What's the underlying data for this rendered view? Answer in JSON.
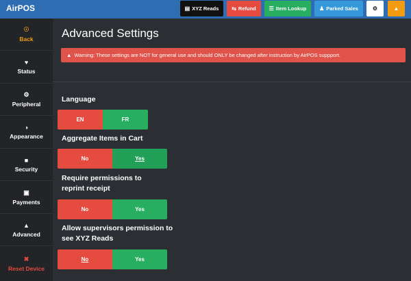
{
  "app": {
    "brand": "AirPOS"
  },
  "topbar": {
    "buttons": [
      {
        "label": "XYZ Reads",
        "icon": "document-icon",
        "color": "#111111"
      },
      {
        "label": "Refund",
        "icon": "refund-icon",
        "color": "#e54b3f"
      },
      {
        "label": "Item Lookup",
        "icon": "list-icon",
        "color": "#27ae60"
      },
      {
        "label": "Parked Sales",
        "icon": "users-icon",
        "color": "#3498db"
      },
      {
        "label": "",
        "icon": "gear-icon",
        "color": "#ffffff"
      },
      {
        "label": "",
        "icon": "bell-icon",
        "color": "#f39c12"
      }
    ]
  },
  "sidebar": {
    "items": [
      {
        "label": "Back",
        "icon": "back-circle-icon",
        "color": "#f39c12"
      },
      {
        "label": "Status",
        "icon": "heart-icon"
      },
      {
        "label": "Peripheral",
        "icon": "gear-icon"
      },
      {
        "label": "Appearance",
        "icon": "half-circle-icon"
      },
      {
        "label": "Security",
        "icon": "lock-icon"
      },
      {
        "label": "Payments",
        "icon": "cart-icon"
      },
      {
        "label": "Advanced",
        "icon": "warning-icon"
      },
      {
        "label": "Reset Device",
        "icon": "close-icon",
        "color": "#e54b3f"
      }
    ]
  },
  "main": {
    "title": "Advanced Settings",
    "warning": "Warning: These settings are NOT for general use and should ONLY be changed after instruction by AirPOS suppport.",
    "settings": [
      {
        "label": "Language",
        "options": [
          "EN",
          "FR"
        ],
        "selected": "EN"
      },
      {
        "label": "Aggregate Items in Cart",
        "options": [
          "No",
          "Yes"
        ],
        "selected": "Yes"
      },
      {
        "label": "Require permissions to reprint receipt",
        "options": [
          "No",
          "Yes"
        ],
        "selected": "No"
      },
      {
        "label": "Allow supervisors permission to see XYZ Reads",
        "options": [
          "No",
          "Yes"
        ],
        "selected": "No"
      }
    ]
  }
}
